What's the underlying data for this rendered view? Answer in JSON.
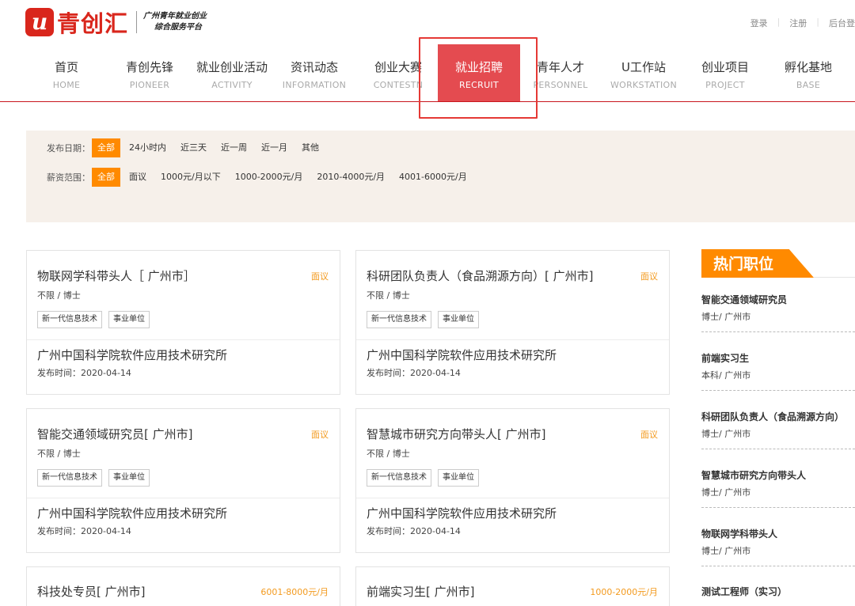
{
  "brand": {
    "logo_letter": "u",
    "name": "青创汇",
    "slogan_line1": "广州青年就业创业",
    "slogan_line2": "综合服务平台"
  },
  "top_links": [
    "登录",
    "注册",
    "后台登"
  ],
  "nav": [
    {
      "cn": "首页",
      "en": "HOME"
    },
    {
      "cn": "青创先锋",
      "en": "PIONEER"
    },
    {
      "cn": "就业创业活动",
      "en": "ACTIVITY"
    },
    {
      "cn": "资讯动态",
      "en": "INFORMATION"
    },
    {
      "cn": "创业大赛",
      "en": "CONTESTN"
    },
    {
      "cn": "就业招聘",
      "en": "RECRUIT"
    },
    {
      "cn": "青年人才",
      "en": "PERSONNEL"
    },
    {
      "cn": "U工作站",
      "en": "WORKSTATION"
    },
    {
      "cn": "创业项目",
      "en": "PROJECT"
    },
    {
      "cn": "孵化基地",
      "en": "BASE"
    }
  ],
  "filters": {
    "date": {
      "label": "发布日期：",
      "options": [
        "全部",
        "24小时内",
        "近三天",
        "近一周",
        "近一月",
        "其他"
      ]
    },
    "salary": {
      "label": "薪资范围：",
      "options": [
        "全部",
        "面议",
        "1000元/月以下",
        "1000-2000元/月",
        "2010-4000元/月",
        "4001-6000元/月"
      ]
    }
  },
  "jobs": [
    {
      "title": "物联网学科带头人［ 广州市］",
      "salary": "面议",
      "req": "不限 / 博士",
      "tags": [
        "新一代信息技术",
        "事业单位"
      ],
      "company": "广州中国科学院软件应用技术研究所",
      "date": "发布时间：2020-04-14"
    },
    {
      "title": "科研团队负责人（食品溯源方向）[ 广州市]",
      "salary": "面议",
      "req": "不限 / 博士",
      "tags": [
        "新一代信息技术",
        "事业单位"
      ],
      "company": "广州中国科学院软件应用技术研究所",
      "date": "发布时间：2020-04-14"
    },
    {
      "title": "智能交通领域研究员[ 广州市]",
      "salary": "面议",
      "req": "不限 / 博士",
      "tags": [
        "新一代信息技术",
        "事业单位"
      ],
      "company": "广州中国科学院软件应用技术研究所",
      "date": "发布时间：2020-04-14"
    },
    {
      "title": "智慧城市研究方向带头人[ 广州市]",
      "salary": "面议",
      "req": "不限 / 博士",
      "tags": [
        "新一代信息技术",
        "事业单位"
      ],
      "company": "广州中国科学院软件应用技术研究所",
      "date": "发布时间：2020-04-14"
    },
    {
      "title": "科技处专员[ 广州市]",
      "salary": "6001-8000元/月"
    },
    {
      "title": "前端实习生[ 广州市]",
      "salary": "1000-2000元/月"
    }
  ],
  "hot": {
    "title": "热门职位",
    "items": [
      {
        "title": "智能交通领域研究员",
        "meta": "博士/  广州市"
      },
      {
        "title": "前端实习生",
        "meta": "本科/  广州市"
      },
      {
        "title": "科研团队负责人（食品溯源方向）",
        "meta": "博士/  广州市"
      },
      {
        "title": "智慧城市研究方向带头人",
        "meta": "博士/  广州市"
      },
      {
        "title": "物联网学科带头人",
        "meta": "博士/  广州市"
      },
      {
        "title": "测试工程师（实习）",
        "meta": ""
      }
    ]
  },
  "colors": {
    "brand_red": "#d9261c",
    "nav_active": "#e44b50",
    "filter_active": "#ff8a00",
    "salary_text": "#f39a1e",
    "filter_bg": "#f6f0ea"
  }
}
